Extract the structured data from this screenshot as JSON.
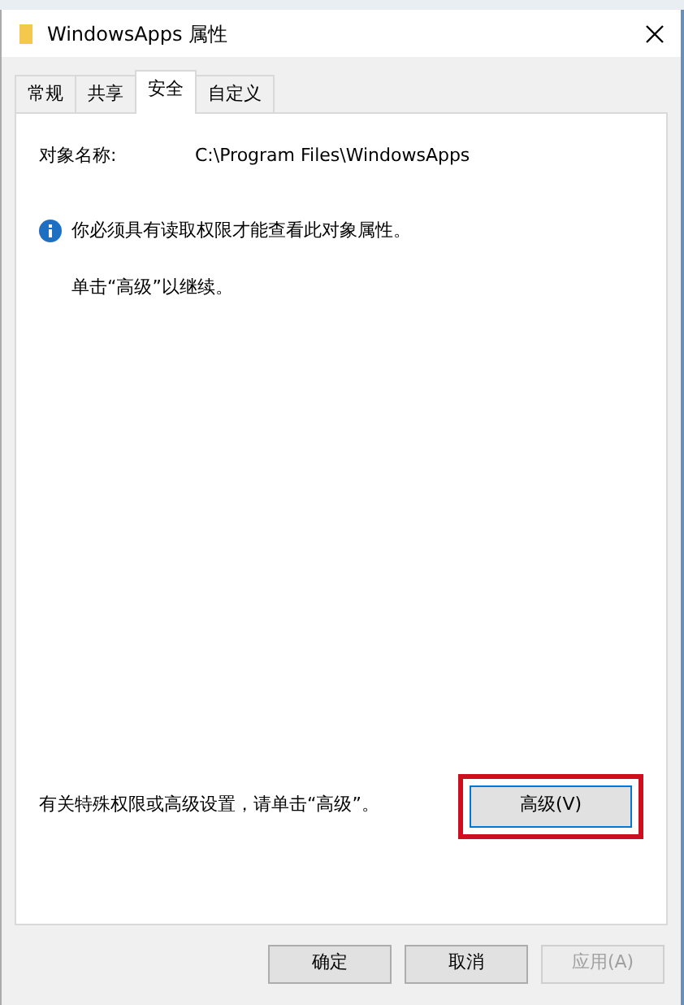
{
  "window": {
    "title": "WindowsApps 属性"
  },
  "tabs": [
    {
      "label": "常规",
      "selected": false
    },
    {
      "label": "共享",
      "selected": false
    },
    {
      "label": "安全",
      "selected": true
    },
    {
      "label": "自定义",
      "selected": false
    }
  ],
  "object_name": {
    "label": "对象名称:",
    "value": "C:\\Program Files\\WindowsApps"
  },
  "info_message": "你必须具有读取权限才能查看此对象属性。",
  "hint": "单击“高级”以继续。",
  "advanced_note": "有关特殊权限或高级设置，请单击“高级”。",
  "advanced_button": {
    "label": "高级(V)",
    "highlighted": true
  },
  "buttons": [
    {
      "label": "确定",
      "disabled": false
    },
    {
      "label": "取消",
      "disabled": false
    },
    {
      "label": "应用(A)",
      "disabled": true
    }
  ]
}
